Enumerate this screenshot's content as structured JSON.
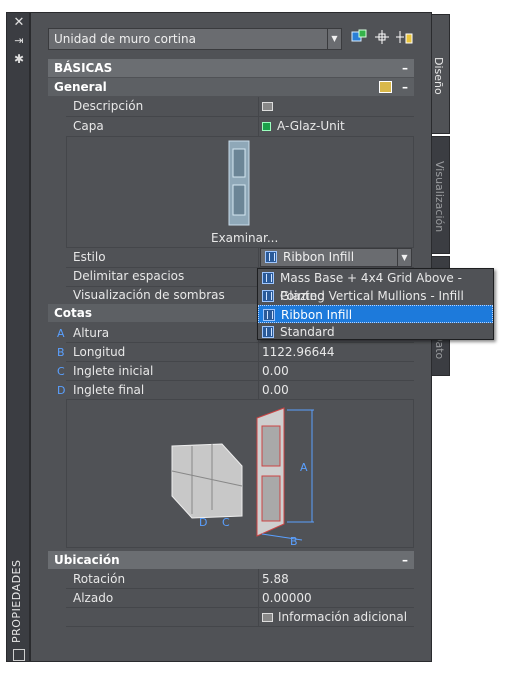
{
  "window": {
    "title_vertical": "PROPIEDADES",
    "close_glyph": "✕",
    "autohide_glyph": "⇥",
    "settings_glyph": "✱"
  },
  "tabs": [
    {
      "label": "Diseño",
      "active": true
    },
    {
      "label": "Visualización",
      "active": false
    },
    {
      "label": "Dato",
      "active": false
    }
  ],
  "object_selector": {
    "value": "Unidad de muro cortina"
  },
  "toolbar": {
    "add_icon": "add-selection-icon",
    "pick_icon": "select-objects-icon",
    "quick_select_icon": "quick-select-icon"
  },
  "sections": {
    "basicas": {
      "title": "BÁSICAS",
      "collapse": "–"
    },
    "general": {
      "title": "General",
      "collapse": "–"
    },
    "cotas": {
      "title": "Cotas"
    },
    "ubicacion": {
      "title": "Ubicación",
      "collapse": "–"
    }
  },
  "general": {
    "descripcion_label": "Descripción",
    "capa_label": "Capa",
    "capa_value": "A-Glaz-Unit",
    "capa_color": "#1aa04a",
    "examinar_label": "Examinar...",
    "estilo_label": "Estilo",
    "estilo_value": "Ribbon Infill",
    "delimitar_label": "Delimitar espacios",
    "sombras_label": "Visualización de sombras"
  },
  "estilo_options": [
    {
      "label": "Mass Base + 4x4 Grid Above - Glazing",
      "selected": false
    },
    {
      "label": "Pointed Vertical Mullions - Infill",
      "selected": false
    },
    {
      "label": "Ribbon Infill",
      "selected": true
    },
    {
      "label": "Standard",
      "selected": false
    }
  ],
  "cotas": {
    "rows": [
      {
        "idx": "A",
        "label": "Altura",
        "value": ""
      },
      {
        "idx": "B",
        "label": "Longitud",
        "value": "1122.96644"
      },
      {
        "idx": "C",
        "label": "Inglete inicial",
        "value": "0.00"
      },
      {
        "idx": "D",
        "label": "Inglete final",
        "value": "0.00"
      }
    ],
    "diagram_labels": {
      "a": "A",
      "b": "B",
      "c": "C",
      "d": "D"
    }
  },
  "ubicacion": {
    "rotacion_label": "Rotación",
    "rotacion_value": "5.88",
    "alzado_label": "Alzado",
    "alzado_value": "0.00000",
    "info_label": "Información adicional"
  },
  "colors": {
    "panel_bg": "#505256",
    "header_bg": "#6b6e72",
    "selection_blue": "#1d7adb",
    "dimension_blue": "#5aa0ff"
  }
}
